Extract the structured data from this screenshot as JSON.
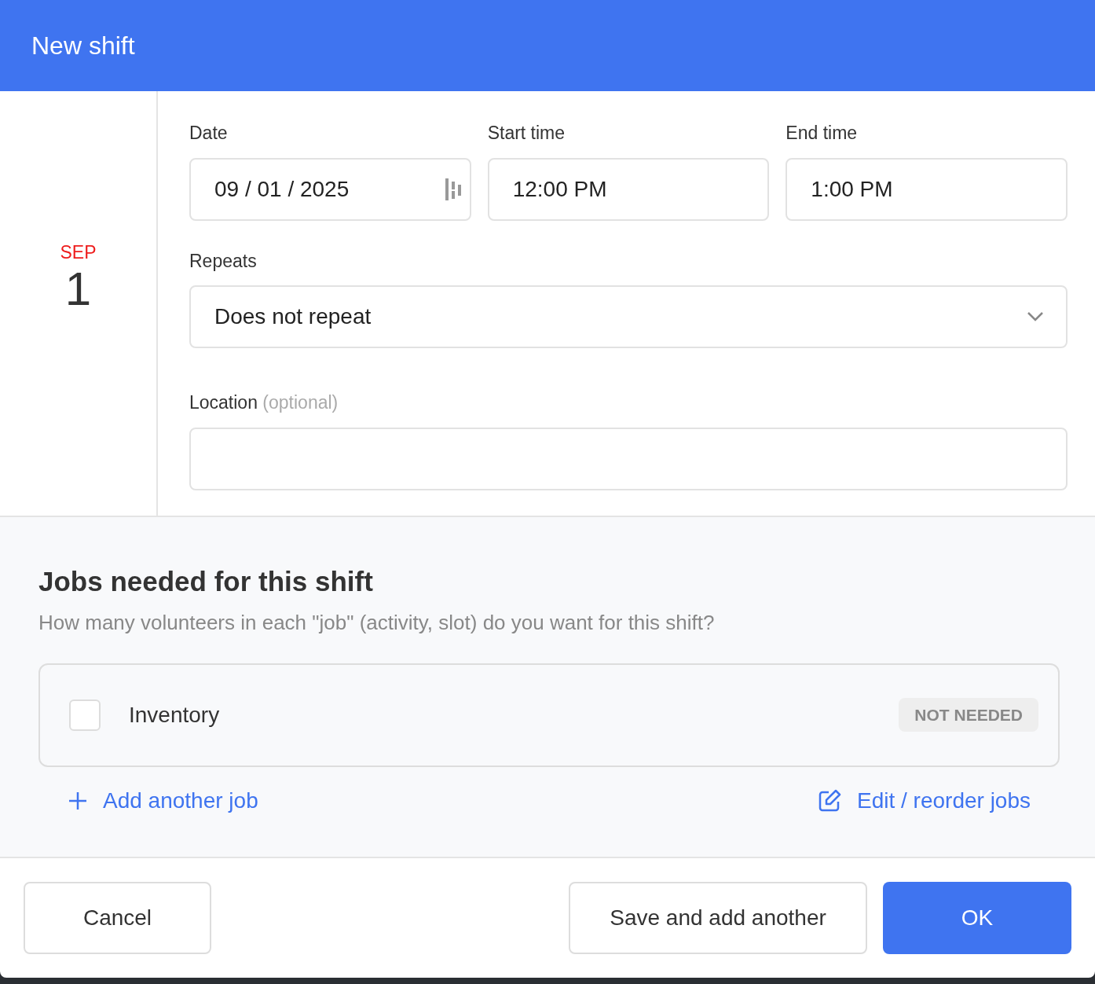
{
  "dialog": {
    "title": "New shift"
  },
  "date_badge": {
    "month": "SEP",
    "day": "1"
  },
  "fields": {
    "date": {
      "label": "Date",
      "value": "09 / 01 / 2025"
    },
    "start_time": {
      "label": "Start time",
      "value": "12:00 PM"
    },
    "end_time": {
      "label": "End time",
      "value": "1:00 PM"
    },
    "repeats": {
      "label": "Repeats",
      "value": "Does not repeat"
    },
    "location": {
      "label": "Location",
      "hint": "(optional)"
    }
  },
  "jobs": {
    "title": "Jobs needed for this shift",
    "subtitle": "How many volunteers in each \"job\" (activity, slot) do you want for this shift?",
    "items": [
      {
        "name": "Inventory",
        "checked": false,
        "status": "NOT NEEDED"
      }
    ],
    "add_link": "Add another job",
    "edit_link": "Edit / reorder jobs"
  },
  "buttons": {
    "cancel": "Cancel",
    "save_another": "Save and add another",
    "ok": "OK"
  }
}
